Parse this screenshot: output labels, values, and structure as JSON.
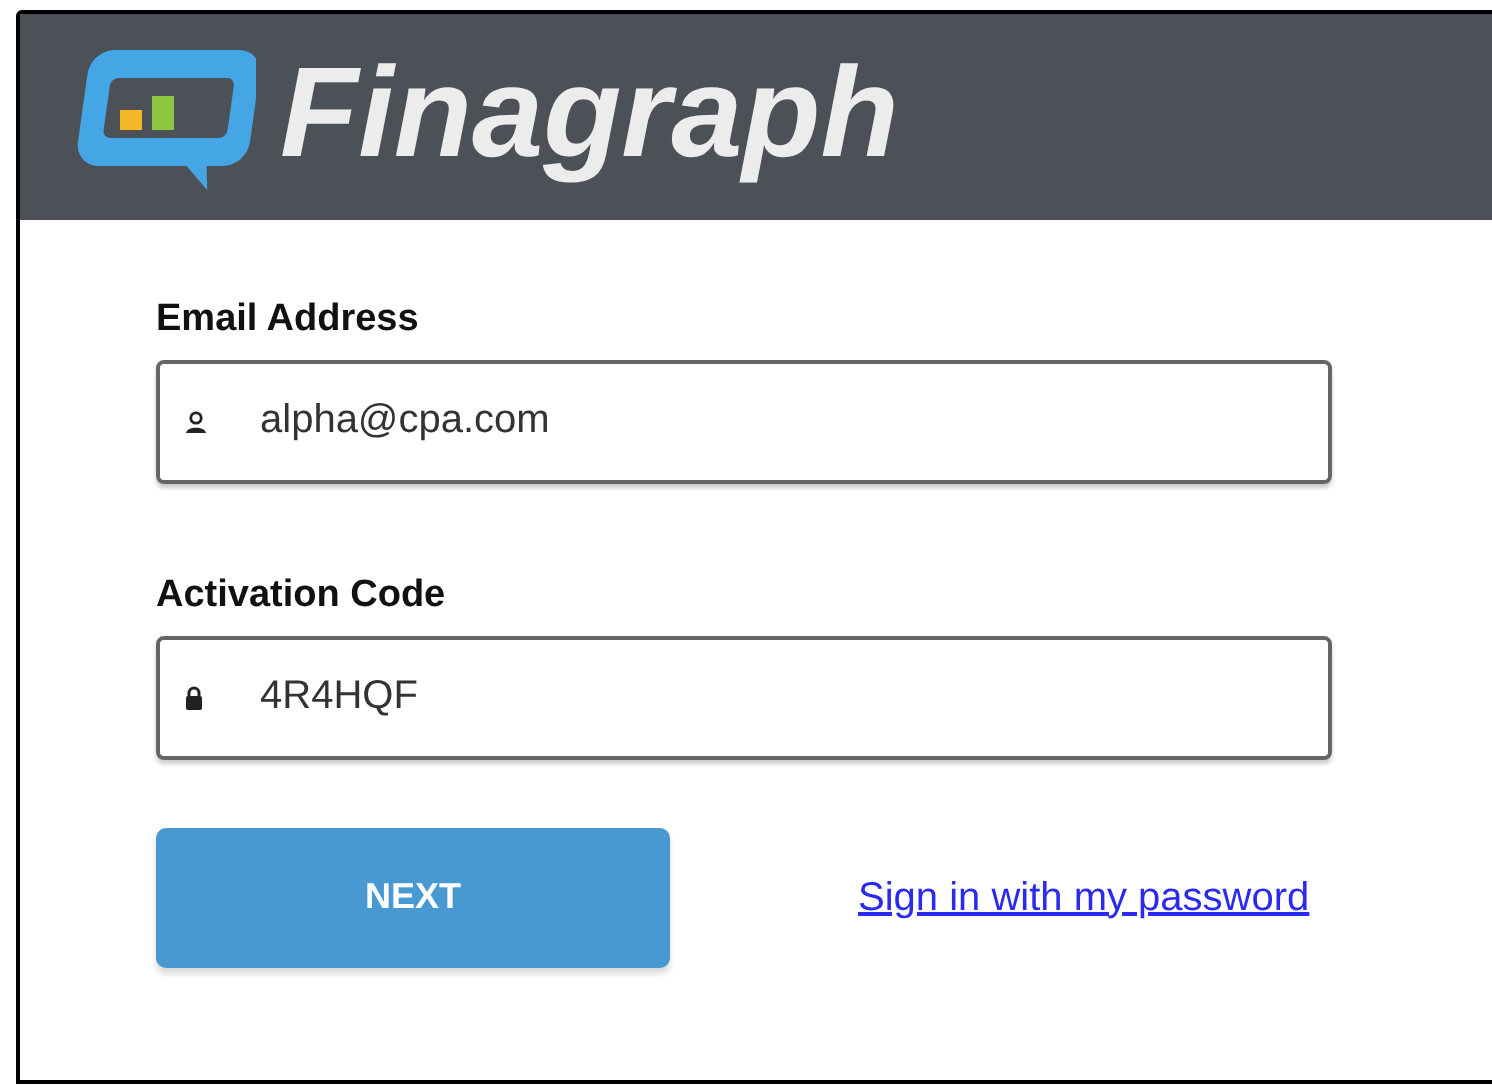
{
  "header": {
    "brand": "Finagraph"
  },
  "fields": [
    {
      "label": "Email Address",
      "value": "alpha@cpa.com",
      "kind": "user"
    },
    {
      "label": "Activation Code",
      "value": "4R4HQF",
      "kind": "lock"
    }
  ],
  "primary_button": "NEXT",
  "link": "Sign in with my password"
}
